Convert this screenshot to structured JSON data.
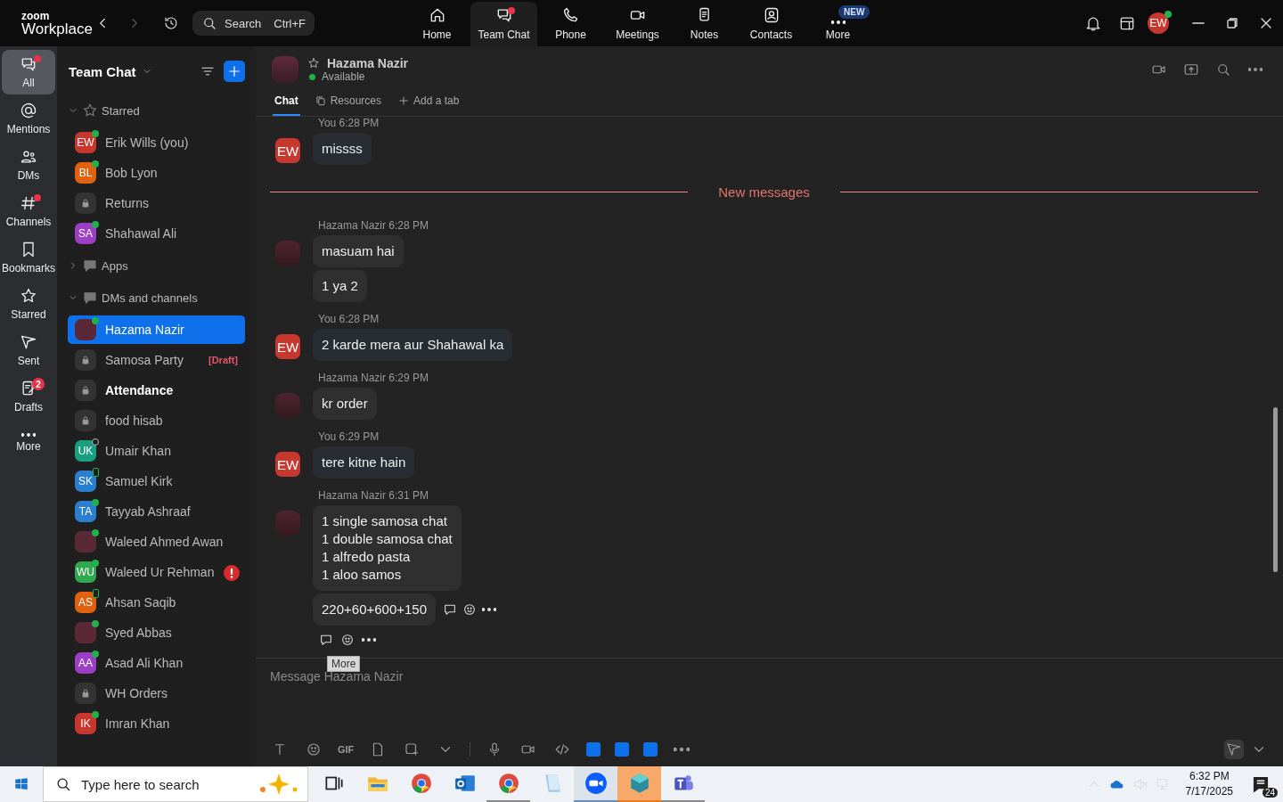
{
  "app": {
    "logo_top": "zoom",
    "logo_bottom": "Workplace",
    "search": {
      "placeholder": "Search",
      "shortcut": "Ctrl+F"
    }
  },
  "nav_tabs": [
    {
      "label": "Home",
      "selected": false,
      "dot": false
    },
    {
      "label": "Team Chat",
      "selected": true,
      "dot": true
    },
    {
      "label": "Phone",
      "selected": false,
      "dot": false
    },
    {
      "label": "Meetings",
      "selected": false,
      "dot": false
    },
    {
      "label": "Notes",
      "selected": false,
      "dot": false
    },
    {
      "label": "Contacts",
      "selected": false,
      "dot": false
    },
    {
      "label": "More",
      "selected": false,
      "dot": false,
      "badge": "NEW"
    }
  ],
  "account": {
    "initials": "EW",
    "color": "#c8372d",
    "online": true
  },
  "rail": [
    {
      "label": "All",
      "selected": true,
      "dot": true
    },
    {
      "label": "Mentions",
      "selected": false,
      "dot": false
    },
    {
      "label": "DMs",
      "selected": false,
      "dot": false
    },
    {
      "label": "Channels",
      "selected": false,
      "dot": true
    },
    {
      "label": "Bookmarks",
      "selected": false,
      "dot": false
    },
    {
      "label": "Starred",
      "selected": false,
      "dot": false
    },
    {
      "label": "Sent",
      "selected": false,
      "dot": false
    },
    {
      "label": "Drafts",
      "selected": false,
      "dot": false,
      "badge": "2"
    },
    {
      "label": "More",
      "selected": false,
      "dot": false
    }
  ],
  "sidebar": {
    "title": "Team Chat",
    "sections": [
      {
        "label": "Starred",
        "expanded": true,
        "children": [
          {
            "name": "Erik Wills (you)",
            "kind": "person",
            "initials": "EW",
            "color": "#c8372d",
            "online": true,
            "on_mobile": false,
            "selected": false
          },
          {
            "name": "Bob Lyon",
            "kind": "person",
            "initials": "BL",
            "color": "#e0620f",
            "online": true,
            "on_mobile": false,
            "selected": false
          },
          {
            "name": "Returns",
            "kind": "channel",
            "selected": false
          },
          {
            "name": "Shahawal Ali",
            "kind": "person",
            "initials": "SA",
            "color": "#9b3fc4",
            "online": true,
            "on_mobile": false,
            "selected": false
          }
        ]
      },
      {
        "label": "Apps",
        "expanded": false
      },
      {
        "label": "DMs and channels",
        "expanded": true,
        "children": [
          {
            "name": "Hazama Nazir",
            "kind": "photo",
            "online": true,
            "on_mobile": false,
            "selected": true
          },
          {
            "name": "Samosa Party",
            "kind": "channel",
            "selected": false,
            "tag": "[Draft]"
          },
          {
            "name": "Attendance",
            "kind": "channel",
            "selected": false,
            "unread": true
          },
          {
            "name": "food hisab",
            "kind": "channel",
            "selected": false
          },
          {
            "name": "Umair Khan",
            "kind": "person",
            "initials": "UK",
            "color": "#1a9e80",
            "online": false,
            "on_mobile": false,
            "selected": false
          },
          {
            "name": "Samuel Kirk",
            "kind": "person",
            "initials": "SK",
            "color": "#2b7fd1",
            "online": true,
            "on_mobile": true,
            "selected": false
          },
          {
            "name": "Tayyab Ashraaf",
            "kind": "person",
            "initials": "TA",
            "color": "#2b7fd1",
            "online": true,
            "on_mobile": false,
            "selected": false
          },
          {
            "name": "Waleed Ahmed Awan",
            "kind": "photo",
            "online": true,
            "on_mobile": false,
            "selected": false
          },
          {
            "name": "Waleed Ur Rehman",
            "kind": "person",
            "initials": "WU",
            "color": "#2fa84f",
            "online": true,
            "on_mobile": false,
            "selected": false,
            "alert": true
          },
          {
            "name": "Ahsan Saqib",
            "kind": "person",
            "initials": "AS",
            "color": "#e0620f",
            "online": true,
            "on_mobile": true,
            "selected": false
          },
          {
            "name": "Syed Abbas",
            "kind": "photo",
            "online": true,
            "on_mobile": false,
            "selected": false
          },
          {
            "name": "Asad Ali Khan",
            "kind": "person",
            "initials": "AA",
            "color": "#9b3fc4",
            "online": true,
            "on_mobile": false,
            "selected": false
          },
          {
            "name": "WH Orders",
            "kind": "channel",
            "selected": false
          },
          {
            "name": "Imran Khan",
            "kind": "person",
            "initials": "IK",
            "color": "#c8372d",
            "online": true,
            "on_mobile": false,
            "selected": false
          }
        ]
      }
    ]
  },
  "conversation": {
    "name": "Hazama Nazir",
    "status": "Available",
    "tabs": [
      {
        "label": "Chat",
        "kind": "tab",
        "selected": true
      },
      {
        "label": "Resources",
        "kind": "tab",
        "selected": false
      },
      {
        "label": "Add a tab",
        "kind": "add"
      }
    ],
    "messages": [
      {
        "kind": "group",
        "sender": "You",
        "time": "6:28 PM",
        "avatar": {
          "kind": "initials",
          "initials": "EW",
          "color": "#c8372d"
        },
        "bubbles": [
          "missss"
        ]
      },
      {
        "kind": "divider",
        "label": "New messages"
      },
      {
        "kind": "group",
        "sender": "Hazama Nazir",
        "time": "6:28 PM",
        "avatar": {
          "kind": "photo"
        },
        "bubbles": [
          "masuam hai",
          "1 ya 2"
        ]
      },
      {
        "kind": "group",
        "sender": "You",
        "time": "6:28 PM",
        "avatar": {
          "kind": "initials",
          "initials": "EW",
          "color": "#c8372d"
        },
        "bubbles": [
          "2 karde mera aur Shahawal ka"
        ]
      },
      {
        "kind": "group",
        "sender": "Hazama Nazir",
        "time": "6:29 PM",
        "avatar": {
          "kind": "photo"
        },
        "bubbles": [
          "kr order"
        ]
      },
      {
        "kind": "group",
        "sender": "You",
        "time": "6:29 PM",
        "avatar": {
          "kind": "initials",
          "initials": "EW",
          "color": "#c8372d"
        },
        "bubbles": [
          "tere kitne hain"
        ]
      },
      {
        "kind": "group",
        "sender": "Hazama Nazir",
        "time": "6:31 PM",
        "avatar": {
          "kind": "photo"
        },
        "bubbles": [
          "1 single samosa chat\n1 double samosa chat\n1 alfredo pasta\n1 aloo samos",
          "220+60+600+150"
        ],
        "hover_actions": true,
        "tooltip": "More"
      }
    ]
  },
  "composer": {
    "placeholder": "Message Hazama Nazir",
    "gif_label": "GIF"
  },
  "taskbar": {
    "search_placeholder": "Type here to search",
    "time": "6:32 PM",
    "date": "7/17/2025",
    "notifications": "24",
    "apps": [
      {
        "kind": "taskview",
        "running": false,
        "focused": false,
        "attention": false
      },
      {
        "kind": "folder",
        "running": false,
        "focused": false,
        "attention": false
      },
      {
        "kind": "chrome",
        "running": false,
        "focused": false,
        "attention": false
      },
      {
        "kind": "outlook",
        "running": false,
        "focused": false,
        "attention": false
      },
      {
        "kind": "chrome",
        "running": true,
        "focused": false,
        "attention": false
      },
      {
        "kind": "notepad",
        "running": false,
        "focused": false,
        "attention": false
      },
      {
        "kind": "zoom",
        "running": true,
        "focused": true,
        "attention": false
      },
      {
        "kind": "cube",
        "running": true,
        "focused": false,
        "attention": true
      },
      {
        "kind": "teams",
        "running": true,
        "focused": false,
        "attention": false
      }
    ]
  }
}
